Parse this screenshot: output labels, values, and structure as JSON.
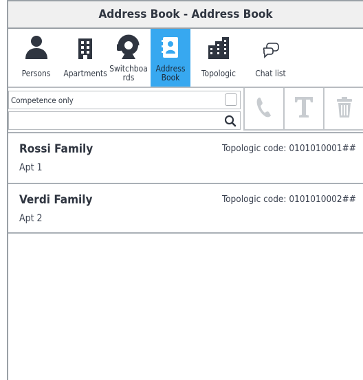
{
  "window": {
    "title": "Address Book - Address Book"
  },
  "toolbar": {
    "tabs": [
      {
        "label": "Persons",
        "icon": "person-icon"
      },
      {
        "label": "Apartments",
        "icon": "building-icon"
      },
      {
        "label": "Switchboards",
        "icon": "operator-headset-icon"
      },
      {
        "label": "Address Book",
        "icon": "address-book-icon"
      },
      {
        "label": "Topologic",
        "icon": "buildings-icon"
      },
      {
        "label": "Chat list",
        "icon": "chat-icon"
      }
    ],
    "active_tab": "Address Book"
  },
  "filters": {
    "competence_label": "Competence only",
    "competence_checked": false,
    "search_value": ""
  },
  "actions": [
    {
      "name": "call",
      "icon": "phone-icon"
    },
    {
      "name": "text",
      "icon": "text-t-icon"
    },
    {
      "name": "delete",
      "icon": "trash-icon"
    }
  ],
  "entries": [
    {
      "name": "Rossi Family",
      "apartment": "Apt 1",
      "topologic_label": "Topologic code:",
      "topologic_code": "0101010001##"
    },
    {
      "name": "Verdi Family",
      "apartment": "Apt 2",
      "topologic_label": "Topologic code:",
      "topologic_code": "0101010002##"
    }
  ],
  "colors": {
    "accent": "#37a8f0",
    "icon_dark": "#2f3540",
    "disabled": "#c8ccd0"
  }
}
